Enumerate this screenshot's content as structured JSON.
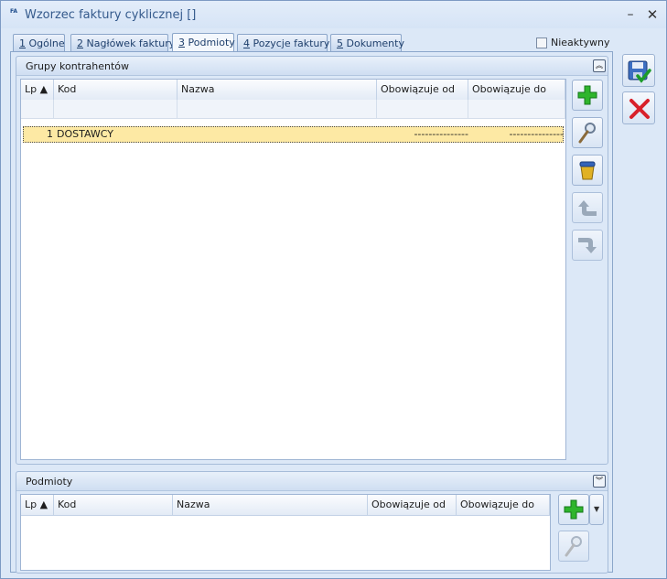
{
  "window": {
    "title": "Wzorzec faktury cyklicznej []",
    "minimize_glyph": "–",
    "close_glyph": "✕",
    "app_icon_text": "FA"
  },
  "tabs": [
    {
      "key": "1",
      "label": " Ogólne"
    },
    {
      "key": "2",
      "label": " Nagłówek faktury"
    },
    {
      "key": "3",
      "label": " Podmioty"
    },
    {
      "key": "4",
      "label": " Pozycje faktury"
    },
    {
      "key": "5",
      "label": " Dokumenty"
    }
  ],
  "active_tab": 2,
  "inactive_checkbox": {
    "label": "Nieaktywny",
    "checked": false
  },
  "groups_section": {
    "title": "Grupy kontrahentów",
    "columns": [
      "Lp ▲",
      "Kod",
      "Nazwa",
      "Obowiązuje od",
      "Obowiązuje do"
    ],
    "rows": [
      {
        "lp": "1",
        "kod": "DOSTAWCY",
        "nazwa": "",
        "od": "---------------",
        "do": "---------------"
      }
    ]
  },
  "entities_section": {
    "title": "Podmioty",
    "columns": [
      "Lp ▲",
      "Kod",
      "Nazwa",
      "Obowiązuje od",
      "Obowiązuje do"
    ]
  },
  "icons": {
    "add": "plus-icon",
    "edit": "magnifier-icon",
    "delete": "trash-icon",
    "up": "arrow-up-icon",
    "down": "arrow-down-icon",
    "save": "save-disk-icon",
    "cancel": "cancel-x-icon",
    "collapse": "collapse-icon",
    "expand": "expand-icon"
  },
  "colors": {
    "selected_row": "#fde9a4",
    "add_green": "#2fb52c",
    "cancel_red": "#d8202a",
    "title_text": "#345a8c"
  }
}
